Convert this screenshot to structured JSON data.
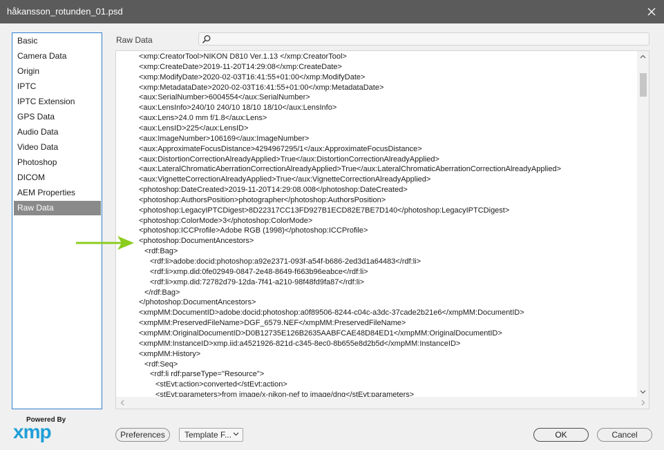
{
  "window": {
    "title": "håkansson_rotunden_01.psd",
    "close_icon": "close-icon"
  },
  "sidebar": {
    "items": [
      {
        "label": "Basic"
      },
      {
        "label": "Camera Data"
      },
      {
        "label": "Origin"
      },
      {
        "label": "IPTC"
      },
      {
        "label": "IPTC Extension"
      },
      {
        "label": "GPS Data"
      },
      {
        "label": "Audio Data"
      },
      {
        "label": "Video Data"
      },
      {
        "label": "Photoshop"
      },
      {
        "label": "DICOM"
      },
      {
        "label": "AEM Properties"
      },
      {
        "label": "Raw Data"
      }
    ],
    "active_index": 11,
    "active_color": "#8a8a8a",
    "border_color": "#2f7fcf"
  },
  "main": {
    "section_label": "Raw Data",
    "search": {
      "value": "",
      "placeholder": "",
      "icon": "search-icon"
    },
    "lines": [
      "<xmp:CreatorTool>NIKON D810 Ver.1.13      </xmp:CreatorTool>",
      "<xmp:CreateDate>2019-11-20T14:29:08</xmp:CreateDate>",
      "<xmp:ModifyDate>2020-02-03T16:41:55+01:00</xmp:ModifyDate>",
      "<xmp:MetadataDate>2020-02-03T16:41:55+01:00</xmp:MetadataDate>",
      "<aux:SerialNumber>6004554</aux:SerialNumber>",
      "<aux:LensInfo>240/10 240/10 18/10 18/10</aux:LensInfo>",
      "<aux:Lens>24.0 mm f/1.8</aux:Lens>",
      "<aux:LensID>225</aux:LensID>",
      "<aux:ImageNumber>106169</aux:ImageNumber>",
      "<aux:ApproximateFocusDistance>4294967295/1</aux:ApproximateFocusDistance>",
      "<aux:DistortionCorrectionAlreadyApplied>True</aux:DistortionCorrectionAlreadyApplied>",
      "<aux:LateralChromaticAberrationCorrectionAlreadyApplied>True</aux:LateralChromaticAberrationCorrectionAlreadyApplied>",
      "<aux:VignetteCorrectionAlreadyApplied>True</aux:VignetteCorrectionAlreadyApplied>",
      "<photoshop:DateCreated>2019-11-20T14:29:08.008</photoshop:DateCreated>",
      "<photoshop:AuthorsPosition>photographer</photoshop:AuthorsPosition>",
      "<photoshop:LegacyIPTCDigest>8D22317CC13FD927B1ECD82E7BE7D140</photoshop:LegacyIPTCDigest>",
      "<photoshop:ColorMode>3</photoshop:ColorMode>",
      "<photoshop:ICCProfile>Adobe RGB (1998)</photoshop:ICCProfile>",
      "<photoshop:DocumentAncestors>",
      "<rdf:Bag>",
      "<rdf:li>adobe:docid:photoshop:a92e2371-093f-a54f-b686-2ed3d1a64483</rdf:li>",
      "<rdf:li>xmp.did:0fe02949-0847-2e48-8649-f663b96eabce</rdf:li>",
      "<rdf:li>xmp.did:72782d79-12da-7f41-a210-98f48fd9fa87</rdf:li>",
      "</rdf:Bag>",
      "</photoshop:DocumentAncestors>",
      "<xmpMM:DocumentID>adobe:docid:photoshop:a0f89506-8244-c04c-a3dc-37cade2b21e6</xmpMM:DocumentID>",
      "<xmpMM:PreservedFileName>DGF_6579.NEF</xmpMM:PreservedFileName>",
      "<xmpMM:OriginalDocumentID>D0B12735E126B2635AABFCAE48D84ED1</xmpMM:OriginalDocumentID>",
      "<xmpMM:InstanceID>xmp.iid:a4521926-821d-c345-8ec0-8b655e8d2b5d</xmpMM:InstanceID>",
      "<xmpMM:History>",
      "<rdf:Seq>",
      "<rdf:li rdf:parseType=\"Resource\">",
      "<stEvt:action>converted</stEvt:action>",
      "<stEvt:parameters>from image/x-nikon-nef to image/dng</stEvt:parameters>"
    ],
    "indent_levels": [
      0,
      0,
      0,
      0,
      0,
      0,
      0,
      0,
      0,
      0,
      0,
      0,
      0,
      0,
      0,
      0,
      0,
      0,
      0,
      1,
      2,
      2,
      2,
      1,
      0,
      0,
      0,
      0,
      0,
      0,
      1,
      2,
      3,
      3
    ],
    "highlight_arrow_color": "#8ccc1f"
  },
  "footer": {
    "powered_by": "Powered By",
    "xmp_logo": "xmp",
    "preferences_label": "Preferences",
    "template_label": "Template F...",
    "ok_label": "OK",
    "cancel_label": "Cancel"
  }
}
